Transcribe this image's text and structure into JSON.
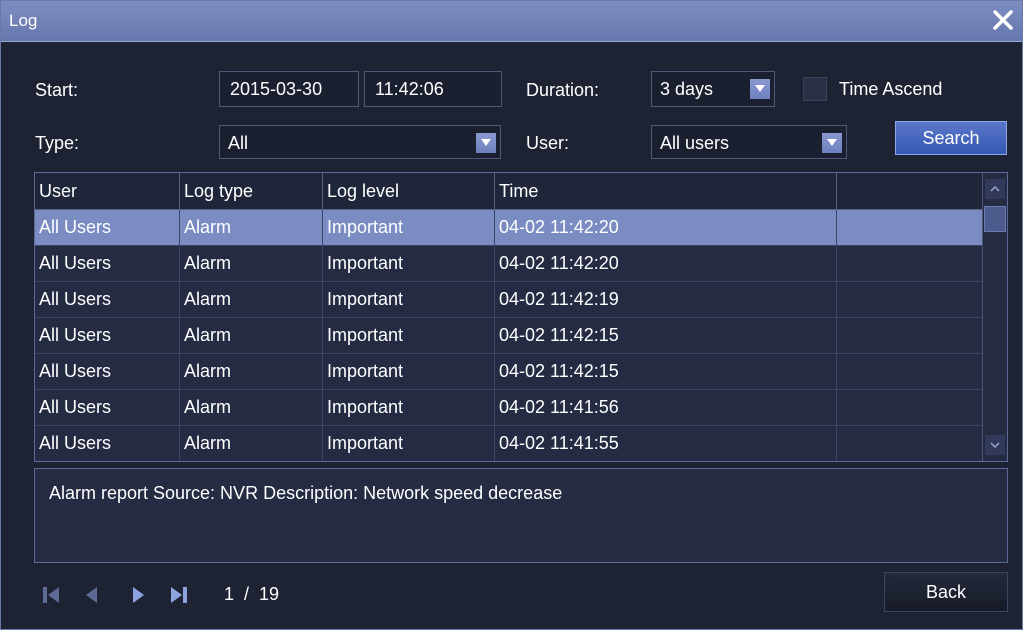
{
  "window": {
    "title": "Log"
  },
  "filters": {
    "start_label": "Start:",
    "start_date": "2015-03-30",
    "start_time": "11:42:06",
    "duration_label": "Duration:",
    "duration_value": "3 days",
    "time_ascend_label": "Time Ascend",
    "time_ascend_checked": false,
    "type_label": "Type:",
    "type_value": "All",
    "user_label": "User:",
    "user_value": "All users",
    "search_label": "Search"
  },
  "table": {
    "columns": [
      "User",
      "Log type",
      "Log level",
      "Time",
      ""
    ],
    "rows": [
      [
        "All Users",
        "Alarm",
        "Important",
        "04-02 11:42:20"
      ],
      [
        "All Users",
        "Alarm",
        "Important",
        "04-02 11:42:20"
      ],
      [
        "All Users",
        "Alarm",
        "Important",
        "04-02 11:42:19"
      ],
      [
        "All Users",
        "Alarm",
        "Important",
        "04-02 11:42:15"
      ],
      [
        "All Users",
        "Alarm",
        "Important",
        "04-02 11:42:15"
      ],
      [
        "All Users",
        "Alarm",
        "Important",
        "04-02 11:41:56"
      ],
      [
        "All Users",
        "Alarm",
        "Important",
        "04-02 11:41:55"
      ]
    ],
    "selected_row": 0
  },
  "detail": {
    "text": "Alarm report Source: NVR Description: Network speed decrease"
  },
  "pager": {
    "page_text": "1  /  19"
  },
  "footer": {
    "back_label": "Back"
  },
  "colors": {
    "accent": "#6677ad",
    "selected_row": "#7a8cc2",
    "nav_icon": "#8ea2e0"
  },
  "icons": [
    "close-icon",
    "first-page-icon",
    "prev-page-icon",
    "next-page-icon",
    "last-page-icon"
  ]
}
